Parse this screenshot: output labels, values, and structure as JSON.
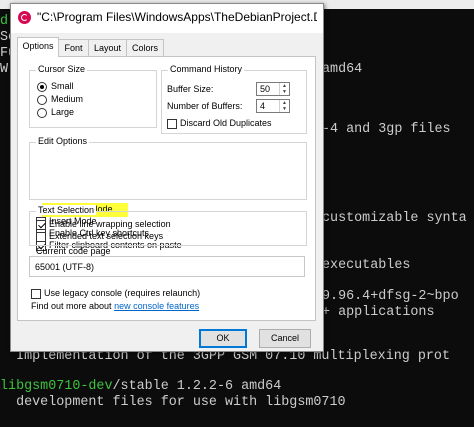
{
  "terminal": {
    "lines_left": [
      "d",
      "Sc",
      "Fu",
      "W",
      "",
      "",
      "",
      "",
      "",
      "",
      "",
      "",
      "",
      "",
      "",
      "",
      ""
    ],
    "lines_right": [
      "",
      "",
      "amd64",
      "",
      "",
      "-4 and 3gp files",
      "",
      "",
      "",
      "customizable synta",
      "",
      "",
      "executables",
      "",
      "9.96.4+dfsg-2~bpo",
      "+ applications"
    ],
    "line_impl": "  Implementation of the 3GPP GSM 07.10 multiplexing prot",
    "line_pkg_green": "libgsm0710-dev",
    "line_pkg_rest": "/stable 1.2.2-6 amd64",
    "line_dev": "  development files for use with libgsm0710"
  },
  "dialog": {
    "title": "\"C:\\Program Files\\WindowsApps\\TheDebianProject.DebianGNUL",
    "tabs": [
      "Options",
      "Font",
      "Layout",
      "Colors"
    ],
    "cursor_size": {
      "title": "Cursor Size",
      "options": [
        "Small",
        "Medium",
        "Large"
      ],
      "selected": "Small"
    },
    "command_history": {
      "title": "Command History",
      "buffer_size_label": "Buffer Size:",
      "buffer_size_value": "50",
      "num_buffers_label": "Number of Buffers:",
      "num_buffers_value": "4",
      "discard_label": "Discard Old Duplicates"
    },
    "edit_options": {
      "title": "Edit Options",
      "items": [
        "QuickEdit Mode",
        "Insert Mode",
        "Enable Ctrl key shortcuts",
        "Filter clipboard contents on paste"
      ]
    },
    "text_selection": {
      "title": "Text Selection",
      "items": [
        "Enable line wrapping selection",
        "Extended text selection keys"
      ]
    },
    "code_page": {
      "title": "Current code page",
      "value": "65001 (UTF-8)"
    },
    "legacy_label": "Use legacy console (requires relaunch)",
    "findout_text": "Find out more about ",
    "findout_link": "new console features",
    "ok_label": "OK",
    "cancel_label": "Cancel",
    "colors": {
      "highlight": "#ffff3a",
      "brand": "#d70751",
      "link": "#0066cc",
      "terminal_green": "#3ec23e"
    }
  }
}
